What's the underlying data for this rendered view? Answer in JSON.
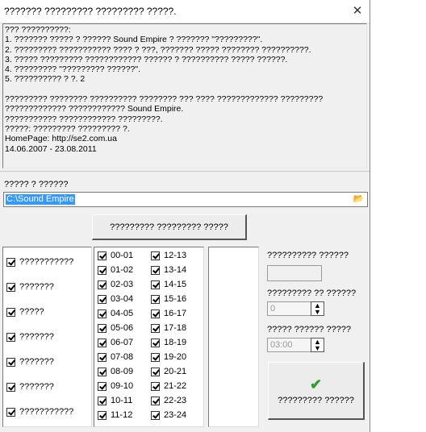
{
  "window": {
    "title": "??????? ????????? ????????? ?????.",
    "close_label": "✕"
  },
  "info_lines": [
    "??? ??????????:",
    "1. ??????? ????? ? ?????? Sound Empire ? ??????? \"?????????\".",
    "2. ????????? ??????????? ???? ? ???, ??????? ????? ???????? ??????????.",
    "3. ????? ????????? ???????????? ?????? ? ?????????? ????? ??????.",
    "4. ????????? \"????????? ??????\".",
    "5. ?????????? ? ?. 2",
    "",
    "????????? ???????? ?????????? ???????? ??? ???? ????????????? ?????????",
    "????????????? ???????????? Sound Empire.",
    "??????????? ???????????? ?????????.",
    "?????: ????????? ????????? ?.",
    "HomePage: http://se2.com.ua",
    "14.06.2007 - 23.08.2011"
  ],
  "folder": {
    "label": "????? ? ??????",
    "value": "C:\\Sound Empire",
    "browse_icon": "📂"
  },
  "process_button": "????????? ????????? ?????",
  "categories": [
    "???????????",
    "???????",
    "?????",
    "???????",
    "???????",
    "???????",
    "???????????"
  ],
  "hours_col1": [
    "00-01",
    "01-02",
    "02-03",
    "03-04",
    "04-05",
    "05-06",
    "06-07",
    "07-08",
    "08-09",
    "09-10",
    "10-11",
    "11-12"
  ],
  "hours_col2": [
    "12-13",
    "13-14",
    "14-15",
    "15-16",
    "16-17",
    "17-18",
    "18-19",
    "19-20",
    "20-21",
    "21-22",
    "22-23",
    "23-24"
  ],
  "right": {
    "label1": "?????????? ??????",
    "label2": "????????? ?? ??????",
    "value2": "0",
    "label3": "????? ?????? ?????",
    "value3": "03:00",
    "start_label": "????????? ??????",
    "start_icon": "✔"
  },
  "colors": {
    "selection": "#3399ff",
    "check_green": "#2ea12e"
  }
}
